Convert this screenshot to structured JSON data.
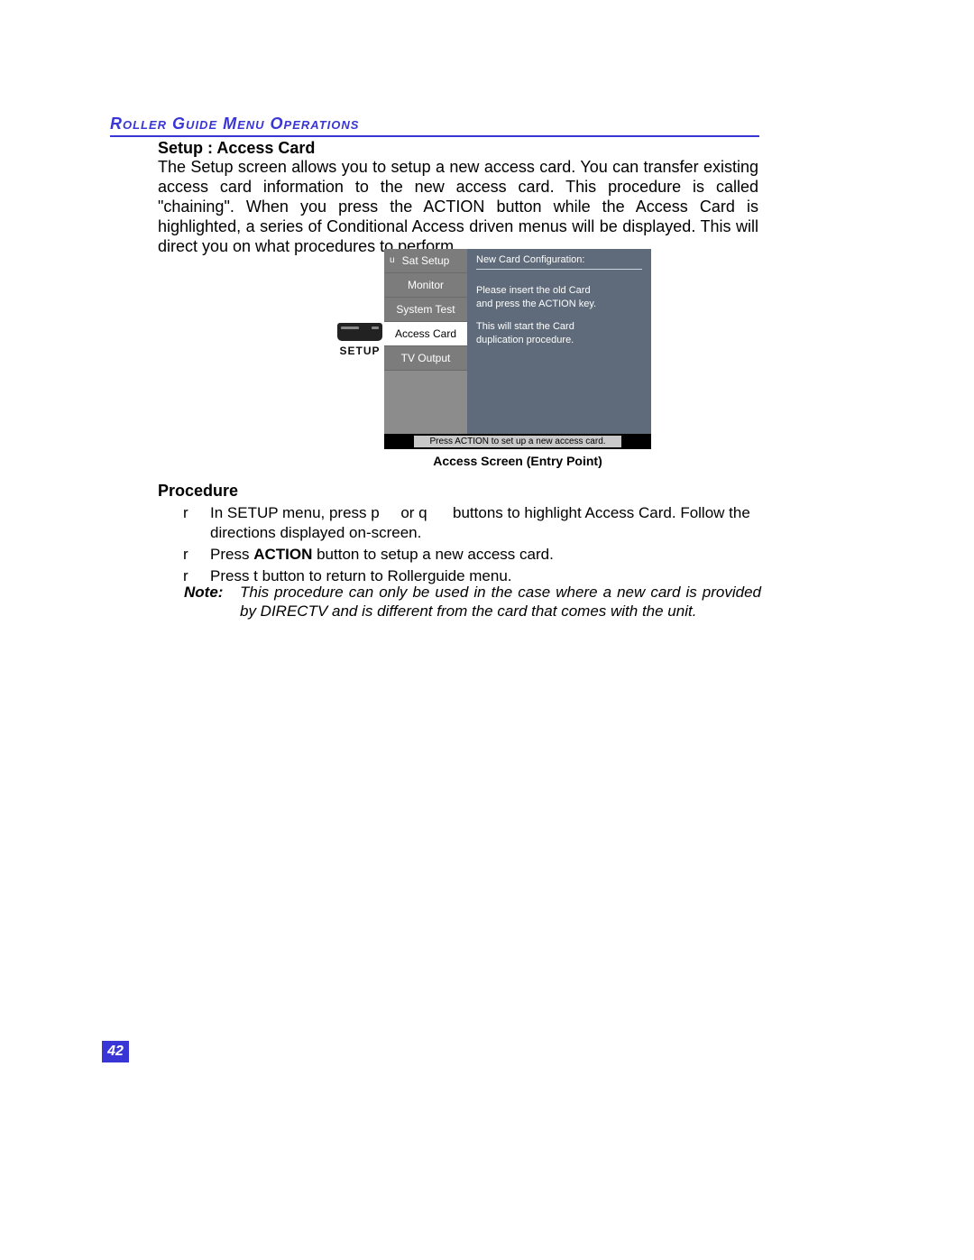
{
  "header": "Roller Guide Menu Operations",
  "sub_header": "Setup : Access Card",
  "body": "The Setup screen allows you to setup a new access card. You can transfer existing access card information to the new access card. This procedure is called \"chaining\". When you press the ACTION button while the Access Card is highlighted, a series of Conditional Access driven menus will be displayed. This will direct you on what procedures to perform.",
  "setup_icon_label": "SETUP",
  "screenshot": {
    "menu": {
      "arrow_glyph": "u",
      "items": [
        "Sat Setup",
        "Monitor",
        "System Test",
        "Access Card",
        "TV Output"
      ],
      "selected_index": 3
    },
    "info": {
      "title": "New Card Configuration:",
      "line1": "Please insert the old Card",
      "line2": "and press the ACTION key.",
      "line3": "This will start the Card",
      "line4": "duplication procedure."
    },
    "footer": "Press ACTION to set up a new access card."
  },
  "caption": "Access Screen (Entry Point)",
  "procedure_header": "Procedure",
  "procedure": {
    "bullet": "r",
    "step1_a": "In SETUP menu, press p",
    "step1_b": " or q ",
    "step1_c": " buttons to highlight Access Card. Follow the directions displayed on-screen.",
    "step2_a": "Press ",
    "step2_b": "ACTION",
    "step2_c": " button to setup a new access card.",
    "step3": "Press  t  button to return to Rollerguide menu."
  },
  "note": {
    "label": "Note:",
    "text": "This procedure can only be used in the case where a new card is provided by DIRECTV and is different from the card that comes with the unit."
  },
  "page_number": "42"
}
